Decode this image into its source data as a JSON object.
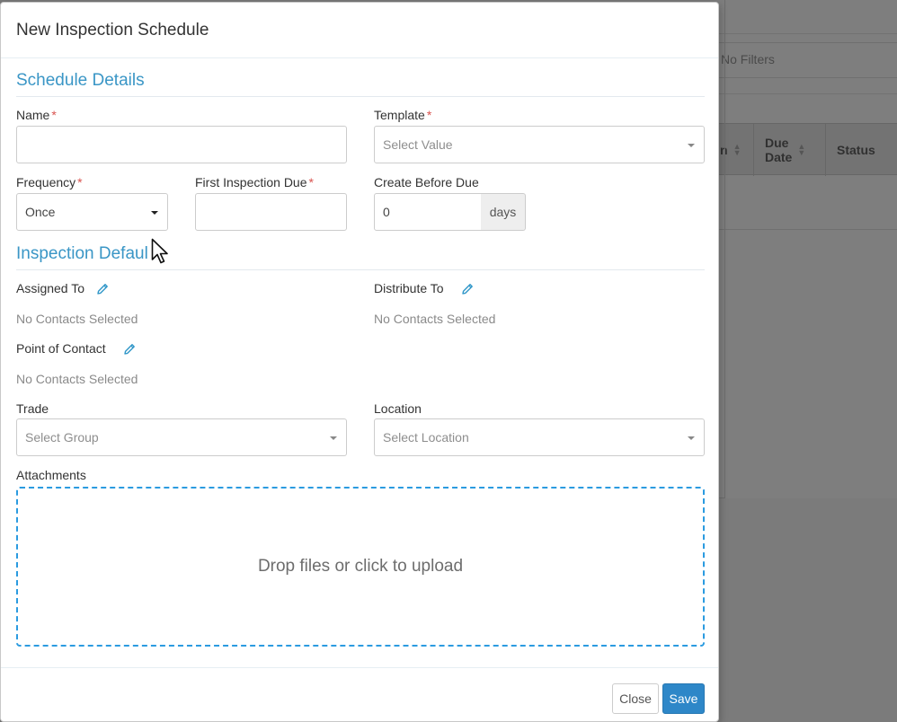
{
  "background": {
    "filter_text": "No Filters",
    "columns": [
      {
        "label": "n"
      },
      {
        "label": "Due\nDate"
      },
      {
        "label": "Status"
      }
    ]
  },
  "modal": {
    "title": "New Inspection Schedule",
    "sections": {
      "schedule_details": "Schedule Details",
      "inspection_defaults": "Inspection Defaul"
    },
    "fields": {
      "name": {
        "label": "Name",
        "required": "*",
        "value": ""
      },
      "template": {
        "label": "Template",
        "required": "*",
        "placeholder": "Select Value"
      },
      "frequency": {
        "label": "Frequency",
        "required": "*",
        "value": "Once"
      },
      "first_inspection_due": {
        "label": "First Inspection Due",
        "required": "*",
        "value": ""
      },
      "create_before_due": {
        "label": "Create Before Due",
        "value": "0",
        "unit": "days"
      },
      "assigned_to": {
        "label": "Assigned To",
        "value": "No Contacts Selected"
      },
      "distribute_to": {
        "label": "Distribute To",
        "value": "No Contacts Selected"
      },
      "point_of_contact": {
        "label": "Point of Contact",
        "value": "No Contacts Selected"
      },
      "trade": {
        "label": "Trade",
        "placeholder": "Select Group"
      },
      "location": {
        "label": "Location",
        "placeholder": "Select Location"
      },
      "attachments": {
        "label": "Attachments",
        "dropzone_text": "Drop files or click to upload"
      }
    },
    "buttons": {
      "close": "Close",
      "save": "Save"
    }
  },
  "colors": {
    "accent": "#3a96c6",
    "primary_button": "#2e87c8",
    "required": "#d9534f",
    "dropzone_border": "#2b9be0"
  },
  "icons": [
    "pencil-icon",
    "caret-down-icon",
    "mouse-cursor-icon"
  ]
}
